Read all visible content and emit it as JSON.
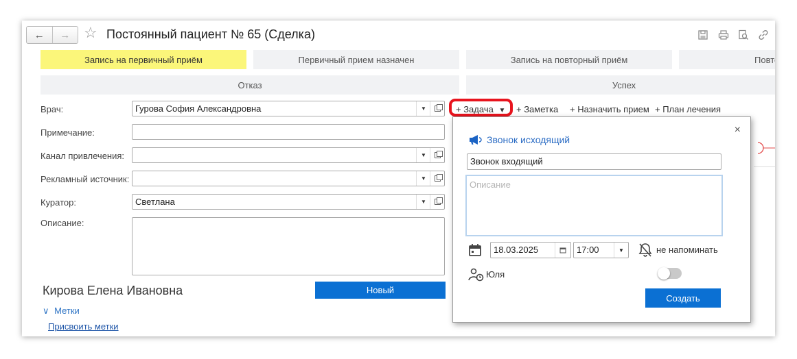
{
  "window": {
    "title": "Постоянный пациент № 65 (Сделка)",
    "nav_back": "←",
    "nav_forward": "→"
  },
  "stages": {
    "row1": [
      "Запись на первичный приём",
      "Первичный прием назначен",
      "Запись на повторный приём",
      "Повторный п"
    ],
    "row2": [
      "Отказ",
      "Успех"
    ],
    "active_color": "#fbf67a"
  },
  "form": {
    "doctor": {
      "label": "Врач:",
      "value": "Гурова София Александровна"
    },
    "note": {
      "label": "Примечание:",
      "value": ""
    },
    "channel": {
      "label": "Канал привлечения:",
      "value": ""
    },
    "ad_source": {
      "label": "Рекламный источник:",
      "value": ""
    },
    "curator": {
      "label": "Куратор:",
      "value": "Светлана"
    },
    "description": {
      "label": "Описание:",
      "value": ""
    }
  },
  "client": {
    "name": "Кирова Елена Ивановна",
    "status_button": "Новый",
    "tags_toggle": "Метки",
    "assign_tags": "Присвоить метки"
  },
  "actions": {
    "task": "+ Задача",
    "note": "+ Заметка",
    "appoint": "+ Назначить прием",
    "plan": "+ План лечения"
  },
  "popup": {
    "close": "×",
    "type_label": "Звонок исходящий",
    "subject": "Звонок входящий",
    "description_placeholder": "Описание",
    "date": "18.03.2025",
    "time": "17:00",
    "reminder": "не напоминать",
    "assignee": "Юля",
    "create_button": "Создать"
  },
  "colors": {
    "accent": "#0b70d3",
    "highlight": "#e8141e",
    "link": "#2d73c4"
  }
}
